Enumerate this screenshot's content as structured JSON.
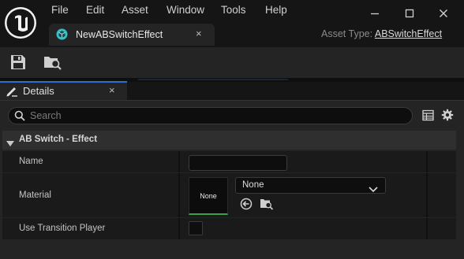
{
  "menu": [
    "File",
    "Edit",
    "Asset",
    "Window",
    "Tools",
    "Help"
  ],
  "icons": {
    "logo": "unreal-logo-icon",
    "tab": "asset-cube-icon",
    "save": "save-icon",
    "browse": "browse-in-content-browser-icon",
    "details": "details-pencil-icon",
    "search": "search-icon",
    "table": "table-view-icon",
    "settings": "gear-icon",
    "collapse": "triangle-down-icon",
    "combo": "chevron-down-icon",
    "use_selected": "use-selected-arrow-icon"
  },
  "window_controls": {
    "minimize": "—",
    "maximize": "☐",
    "close": "✕"
  },
  "tab": {
    "label": "NewABSwitchEffect",
    "close": "×"
  },
  "asset_type": {
    "label": "Asset Type: ",
    "value": "ABSwitchEffect"
  },
  "details_tab": {
    "label": "Details",
    "close": "×"
  },
  "search": {
    "placeholder": "Search",
    "value": ""
  },
  "category": {
    "label": "AB Switch - Effect"
  },
  "properties": {
    "name": {
      "label": "Name",
      "value": ""
    },
    "material": {
      "label": "Material",
      "thumbnail_label": "None",
      "selected": "None"
    },
    "use_transition_player": {
      "label": "Use Transition Player",
      "checked": false
    }
  },
  "colors": {
    "accent_blue": "#2f6fcf",
    "material_green": "#3aa04a",
    "tab_icon_teal": "#35c0c8"
  }
}
